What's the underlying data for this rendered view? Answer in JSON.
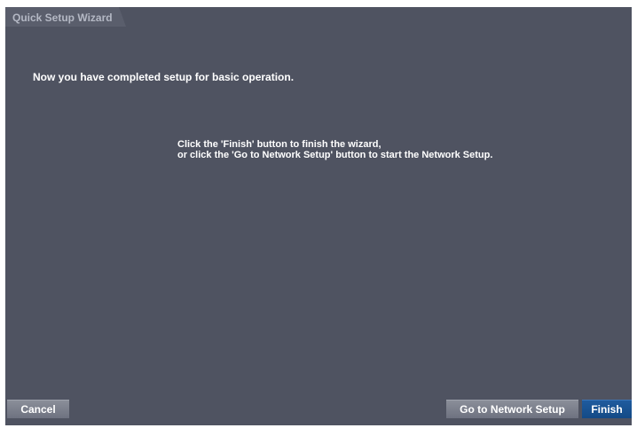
{
  "window": {
    "title": "Quick Setup Wizard"
  },
  "content": {
    "headline": "Now you have completed setup for basic operation.",
    "instruction_line1": "Click the 'Finish' button to finish the wizard,",
    "instruction_line2": "or click the 'Go to Network Setup' button to start the Network Setup."
  },
  "buttons": {
    "cancel": "Cancel",
    "network_setup": "Go to Network Setup",
    "finish": "Finish"
  },
  "colors": {
    "panel_background": "#4f5361",
    "primary_button": "#1f5b9e",
    "secondary_button": "#7b7f8b",
    "text": "#ffffff"
  }
}
